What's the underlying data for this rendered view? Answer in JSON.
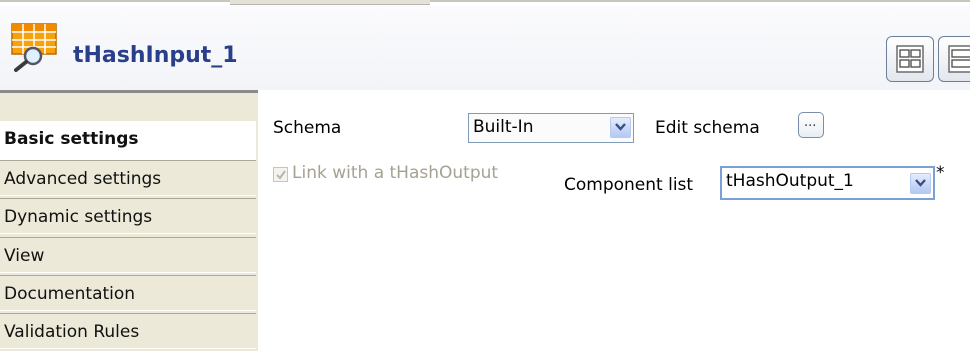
{
  "component": {
    "title": "tHashInput_1",
    "icon": "table-magnifier-icon"
  },
  "layout_buttons": [
    "layout-grid-icon",
    "layout-rows-icon"
  ],
  "tabs": [
    {
      "label": "Basic settings",
      "active": true
    },
    {
      "label": "Advanced settings",
      "active": false
    },
    {
      "label": "Dynamic settings",
      "active": false
    },
    {
      "label": "View",
      "active": false
    },
    {
      "label": "Documentation",
      "active": false
    },
    {
      "label": "Validation Rules",
      "active": false
    }
  ],
  "settings": {
    "schema_label": "Schema",
    "schema_value": "Built-In",
    "edit_schema_label": "Edit schema",
    "edit_schema_button": "...",
    "link_label": "Link with a tHashOutput",
    "link_checked": true,
    "link_enabled": false,
    "component_list_label": "Component list",
    "component_list_value": "tHashOutput_1",
    "required_marker": "*"
  },
  "colors": {
    "title": "#2a3f8c",
    "tab_bg": "#ece9d8",
    "disabled_text": "#a5a292",
    "combo_border": "#7aa0d6"
  }
}
